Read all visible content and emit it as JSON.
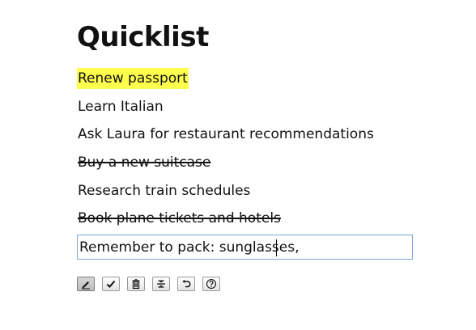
{
  "app": {
    "title": "Quicklist"
  },
  "items": [
    {
      "text": "Renew passport",
      "highlighted": true,
      "done": false
    },
    {
      "text": "Learn Italian",
      "highlighted": false,
      "done": false
    },
    {
      "text": "Ask Laura for restaurant recommendations",
      "highlighted": false,
      "done": false
    },
    {
      "text": "Buy a new suitcase",
      "highlighted": false,
      "done": true
    },
    {
      "text": "Research train schedules",
      "highlighted": false,
      "done": false
    },
    {
      "text": "Book plane tickets and hotels",
      "highlighted": false,
      "done": true
    }
  ],
  "input": {
    "value": "Remember to pack: sunglasses,"
  },
  "toolbar": {
    "buttons": [
      {
        "icon": "pencil-icon",
        "active": true
      },
      {
        "icon": "checkmark-icon",
        "active": false
      },
      {
        "icon": "trash-icon",
        "active": false
      },
      {
        "icon": "strikethrough-icon",
        "active": false
      },
      {
        "icon": "undo-icon",
        "active": false
      },
      {
        "icon": "help-icon",
        "active": false
      }
    ]
  },
  "colors": {
    "highlight": "#ffff4d",
    "input_border": "#7aa7d8"
  }
}
